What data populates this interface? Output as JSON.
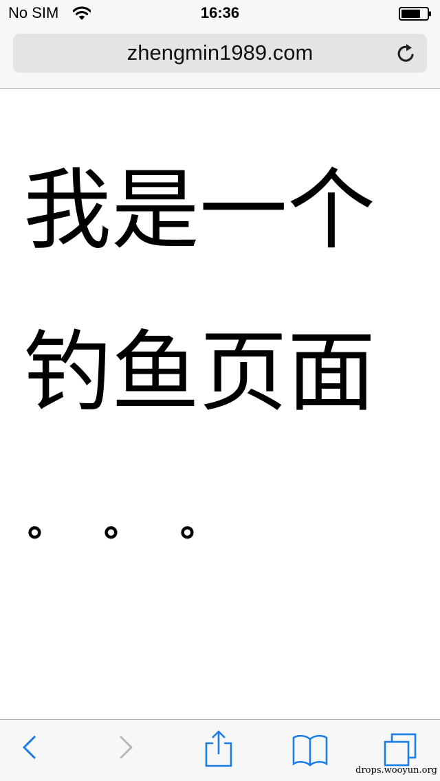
{
  "status_bar": {
    "carrier": "No SIM",
    "time": "16:36",
    "wifi_icon": "wifi-icon",
    "battery_icon": "battery-icon"
  },
  "browser": {
    "url": "zhengmin1989.com",
    "reload_icon": "reload-icon"
  },
  "page": {
    "heading": "我是一个钓鱼页面",
    "ellipsis": "。。。"
  },
  "toolbar": {
    "back_icon": "chevron-left-icon",
    "forward_icon": "chevron-right-icon",
    "share_icon": "share-icon",
    "bookmarks_icon": "book-icon",
    "tabs_icon": "tabs-icon",
    "accent_color": "#1a7ce6",
    "disabled_color": "#b8b8b8"
  },
  "watermark": "drops.wooyun.org"
}
